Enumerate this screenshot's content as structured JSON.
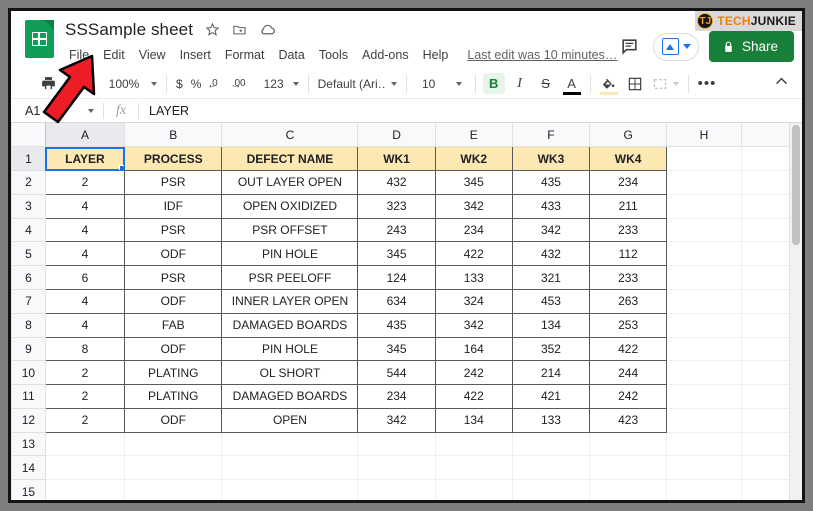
{
  "app": {
    "doc_title": "SSSample sheet",
    "doc_icon": "sheets-icon",
    "title_icons": [
      "star-icon",
      "move-to-folder-icon",
      "cloud-status-icon"
    ],
    "last_edit": "Last edit was 10 minutes…"
  },
  "menu": {
    "items": [
      "File",
      "Edit",
      "View",
      "Insert",
      "Format",
      "Data",
      "Tools",
      "Add-ons",
      "Help"
    ]
  },
  "header_actions": {
    "comment_icon": "comment-icon",
    "present_icon": "present-upload-icon",
    "present_caret": "chevron-down-icon",
    "share_label": "Share",
    "share_lock_icon": "lock-icon",
    "share_color": "#188038"
  },
  "watermark": {
    "badge": "TJ",
    "part1": "TECH",
    "part2": "JUNKIE",
    "color1": "#e8820c",
    "color2": "#1a1a1a"
  },
  "toolbar": {
    "print_icon": "print-icon",
    "paint_format_icon": "paint-format-icon",
    "zoom_value": "100%",
    "currency_label": "$",
    "percent_label": "%",
    "decrease_decimal_label": ".0",
    "increase_decimal_label": ".00",
    "more_formats_label": "123",
    "font_name": "Default (Ari…",
    "font_size": "10",
    "bold_label": "B",
    "italic_label": "I",
    "strikethrough_label": "S",
    "text_color_label": "A",
    "fill_color_icon": "fill-color-icon",
    "fill_color_swatch": "#fce8b2",
    "borders_icon": "borders-icon",
    "merge_icon": "merge-cells-icon",
    "more_icon": "more-options-icon",
    "collapse_icon": "chevron-up-icon",
    "bold_active_bg": "#e6f4ea",
    "bold_active_fg": "#188038"
  },
  "formula_bar": {
    "name_box": "A1",
    "fx_label": "fx",
    "value": "LAYER"
  },
  "annotation": {
    "type": "red-arrow",
    "points_to": "File",
    "color": "#ee1c25"
  },
  "sheet": {
    "columns": [
      "A",
      "B",
      "C",
      "D",
      "E",
      "F",
      "G",
      "H"
    ],
    "selected_cell": "A1",
    "selected_column": "A",
    "selected_row": 1,
    "header_fill": "#fce8b2",
    "row_numbers": [
      1,
      2,
      3,
      4,
      5,
      6,
      7,
      8,
      9,
      10,
      11,
      12,
      13,
      14,
      15
    ],
    "header_row": [
      "LAYER",
      "PROCESS",
      "DEFECT NAME",
      "WK1",
      "WK2",
      "WK3",
      "WK4"
    ],
    "rows": [
      [
        "2",
        "PSR",
        "OUT LAYER OPEN",
        "432",
        "345",
        "435",
        "234"
      ],
      [
        "4",
        "IDF",
        "OPEN OXIDIZED",
        "323",
        "342",
        "433",
        "211"
      ],
      [
        "4",
        "PSR",
        "PSR OFFSET",
        "243",
        "234",
        "342",
        "233"
      ],
      [
        "4",
        "ODF",
        "PIN HOLE",
        "345",
        "422",
        "432",
        "112"
      ],
      [
        "6",
        "PSR",
        "PSR PEELOFF",
        "124",
        "133",
        "321",
        "233"
      ],
      [
        "4",
        "ODF",
        "INNER LAYER OPEN",
        "634",
        "324",
        "453",
        "263"
      ],
      [
        "4",
        "FAB",
        "DAMAGED BOARDS",
        "435",
        "342",
        "134",
        "253"
      ],
      [
        "8",
        "ODF",
        "PIN HOLE",
        "345",
        "164",
        "352",
        "422"
      ],
      [
        "2",
        "PLATING",
        "OL SHORT",
        "544",
        "242",
        "214",
        "244"
      ],
      [
        "2",
        "PLATING",
        "DAMAGED BOARDS",
        "234",
        "422",
        "421",
        "242"
      ],
      [
        "2",
        "ODF",
        "OPEN",
        "342",
        "134",
        "133",
        "423"
      ]
    ],
    "empty_rows": [
      13,
      14,
      15
    ]
  }
}
